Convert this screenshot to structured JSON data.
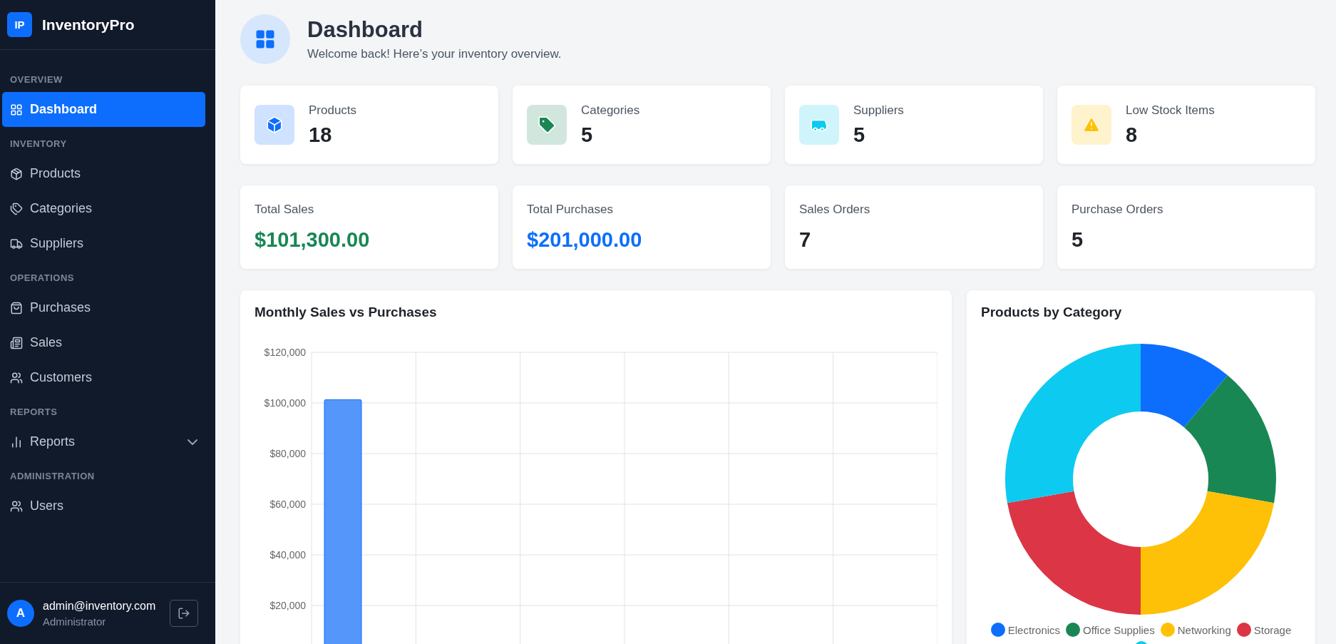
{
  "brand": {
    "logo": "IP",
    "name": "InventoryPro"
  },
  "sidebar": {
    "sections": [
      {
        "title": "OVERVIEW",
        "items": [
          {
            "label": "Dashboard",
            "selected": true
          }
        ]
      },
      {
        "title": "INVENTORY",
        "items": [
          {
            "label": "Products",
            "selected": false
          },
          {
            "label": "Categories",
            "selected": false
          },
          {
            "label": "Suppliers",
            "selected": false
          }
        ]
      },
      {
        "title": "OPERATIONS",
        "items": [
          {
            "label": "Purchases",
            "selected": false
          },
          {
            "label": "Sales",
            "selected": false
          },
          {
            "label": "Customers",
            "selected": false
          }
        ]
      },
      {
        "title": "REPORTS",
        "items": [
          {
            "label": "Reports",
            "selected": false,
            "expanded": false
          }
        ]
      },
      {
        "title": "ADMINISTRATION",
        "items": [
          {
            "label": "Users",
            "selected": false
          }
        ]
      }
    ]
  },
  "user": {
    "initial": "A",
    "email": "admin@inventory.com",
    "role": "Administrator"
  },
  "header": {
    "title": "Dashboard",
    "subtitle": "Welcome back! Here’s your inventory overview."
  },
  "stat_cards": [
    {
      "label": "Products",
      "value": "18",
      "color": "#0d6efd"
    },
    {
      "label": "Categories",
      "value": "5",
      "color": "#198754"
    },
    {
      "label": "Suppliers",
      "value": "5",
      "color": "#0dcaf0"
    },
    {
      "label": "Low Stock Items",
      "value": "8",
      "color": "#ffc107"
    }
  ],
  "summary_cards": [
    {
      "label": "Total Sales",
      "value": "$101,300.00",
      "color": "#198754"
    },
    {
      "label": "Total Purchases",
      "value": "$201,000.00",
      "color": "#0d6efd"
    },
    {
      "label": "Sales Orders",
      "value": "7",
      "color": "#212529"
    },
    {
      "label": "Purchase Orders",
      "value": "5",
      "color": "#212529"
    }
  ],
  "sales_chart": {
    "title": "Monthly Sales vs Purchases",
    "chart_data": {
      "type": "bar",
      "grid": true,
      "values": [
        101300,
        0,
        0,
        0,
        0,
        0
      ],
      "ylim": [
        0,
        120000
      ],
      "yticks": [
        {
          "value": 20000,
          "label": "$20,000"
        },
        {
          "value": 40000,
          "label": "$40,000"
        },
        {
          "value": 60000,
          "label": "$60,000"
        },
        {
          "value": 80000,
          "label": "$80,000"
        },
        {
          "value": 100000,
          "label": "$100,000"
        },
        {
          "value": 120000,
          "label": "$120,000"
        }
      ]
    }
  },
  "category_chart": {
    "title": "Products by Category",
    "chart_data": {
      "type": "donut",
      "categories": [
        "Electronics",
        "Office Supplies",
        "Networking",
        "Storage",
        null
      ],
      "values": [
        11.1,
        16.7,
        22.2,
        22.2,
        27.8
      ],
      "colors": [
        "#0d6efd",
        "#198754",
        "#ffc107",
        "#dc3545",
        "#0dcaf0"
      ]
    }
  }
}
